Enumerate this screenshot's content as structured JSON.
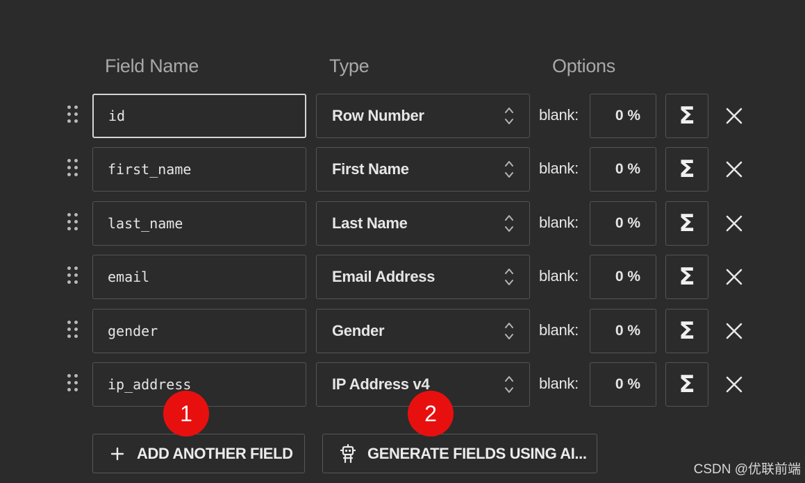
{
  "headers": {
    "field_name": "Field Name",
    "type": "Type",
    "options": "Options"
  },
  "fields": [
    {
      "name": "id",
      "type": "Row Number",
      "blank_label": "blank:",
      "blank_value": "0 %"
    },
    {
      "name": "first_name",
      "type": "First Name",
      "blank_label": "blank:",
      "blank_value": "0 %"
    },
    {
      "name": "last_name",
      "type": "Last Name",
      "blank_label": "blank:",
      "blank_value": "0 %"
    },
    {
      "name": "email",
      "type": "Email Address",
      "blank_label": "blank:",
      "blank_value": "0 %"
    },
    {
      "name": "gender",
      "type": "Gender",
      "blank_label": "blank:",
      "blank_value": "0 %"
    },
    {
      "name": "ip_address",
      "type": "IP Address v4",
      "blank_label": "blank:",
      "blank_value": "0 %"
    }
  ],
  "formula_symbol": "Σ",
  "actions": {
    "add_field": "ADD ANOTHER FIELD",
    "generate_ai": "GENERATE FIELDS USING AI..."
  },
  "annotations": {
    "badge_1": "1",
    "badge_2": "2"
  },
  "watermark": "CSDN @优联前端",
  "icons": {
    "drag": "drag-handle-icon",
    "updown": "sort-updown-icon",
    "remove": "close-icon",
    "add": "plus-icon",
    "ai": "robot-icon"
  },
  "colors": {
    "background": "#2b2b2b",
    "badge": "#e8100f",
    "header_text": "#a9a9a9"
  }
}
